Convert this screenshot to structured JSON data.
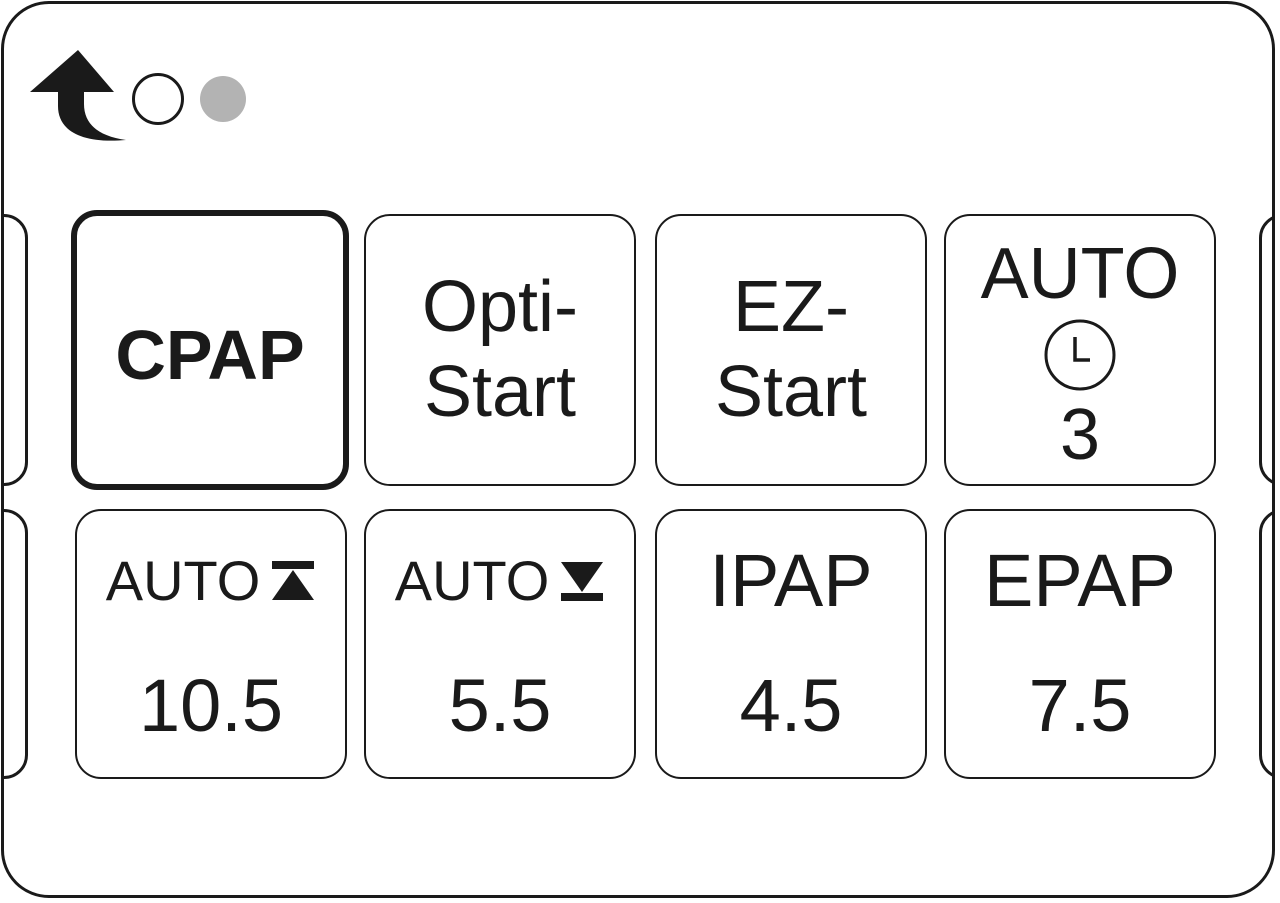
{
  "header": {
    "back_icon": "back-arrow-icon",
    "page_indicator": {
      "current": 2,
      "total": 2
    }
  },
  "modes": [
    {
      "label": "CPAP",
      "selected": true
    },
    {
      "label_line1": "Opti-",
      "label_line2": "Start"
    },
    {
      "label_line1": "EZ-",
      "label_line2": "Start"
    },
    {
      "label_top": "AUTO",
      "icon": "clock-icon",
      "value": "3"
    }
  ],
  "settings": [
    {
      "label": "AUTO",
      "icon": "max-limit-icon",
      "value": "10.5"
    },
    {
      "label": "AUTO",
      "icon": "min-limit-icon",
      "value": "5.5"
    },
    {
      "label": "IPAP",
      "value": "4.5"
    },
    {
      "label": "EPAP",
      "value": "7.5"
    }
  ],
  "colors": {
    "stroke": "#1a1a1a",
    "inactive_dot": "#b3b3b3",
    "background": "#ffffff"
  }
}
